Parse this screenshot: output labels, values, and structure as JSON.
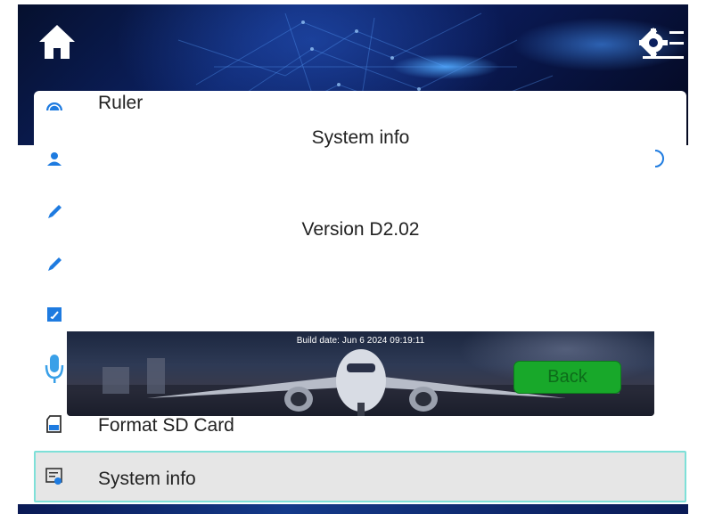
{
  "header": {
    "home_icon": "home-icon",
    "settings_icon": "settings-list-icon"
  },
  "menu": {
    "items": [
      {
        "label": "Ruler",
        "icon": "ruler-gauge-icon"
      },
      {
        "label": "",
        "icon": "user-icon"
      },
      {
        "label": "",
        "icon": "pen-icon"
      },
      {
        "label": "",
        "icon": "pencil-icon"
      },
      {
        "label": "",
        "icon": "edit-document-icon"
      },
      {
        "label": "",
        "icon": "microphone-icon"
      },
      {
        "label": "Format SD Card",
        "icon": "sd-card-icon"
      },
      {
        "label": "System info",
        "icon": "system-info-icon",
        "selected": true
      }
    ]
  },
  "dialog": {
    "title": "System info",
    "version": "Version D2.02",
    "build_date": "Build date: Jun  6 2024 09:19:11",
    "back_label": "Back"
  },
  "colors": {
    "accent_blue": "#0a1a55",
    "selection_border": "#7ee0d8",
    "back_button": "#18a82a"
  }
}
